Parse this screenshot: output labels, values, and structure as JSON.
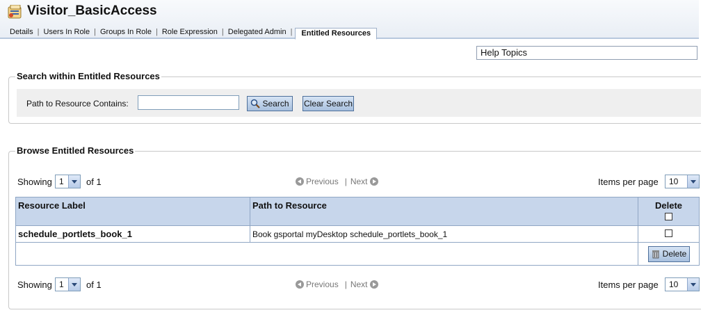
{
  "header": {
    "title": "Visitor_BasicAccess",
    "tabs": [
      {
        "label": "Details"
      },
      {
        "label": "Users In Role"
      },
      {
        "label": "Groups In Role"
      },
      {
        "label": "Role Expression"
      },
      {
        "label": "Delegated Admin"
      },
      {
        "label": "Entitled Resources"
      }
    ]
  },
  "help": {
    "label": "Help Topics"
  },
  "search": {
    "legend": "Search within Entitled Resources",
    "path_label": "Path to Resource Contains:",
    "path_value": "",
    "search_button": "Search",
    "clear_button": "Clear Search"
  },
  "browse": {
    "legend": "Browse Entitled Resources",
    "showing_label": "Showing",
    "page_value": "1",
    "of_label": "of 1",
    "previous": "Previous",
    "separator": "|",
    "next": "Next",
    "items_per_page_label": "Items per page",
    "items_per_page_value": "10",
    "columns": [
      "Resource Label",
      "Path to Resource",
      "Delete"
    ],
    "rows": [
      {
        "label": "schedule_portlets_book_1",
        "path": "Book gsportal myDesktop schedule_portlets_book_1",
        "checked": false
      }
    ],
    "delete_button": "Delete"
  }
}
